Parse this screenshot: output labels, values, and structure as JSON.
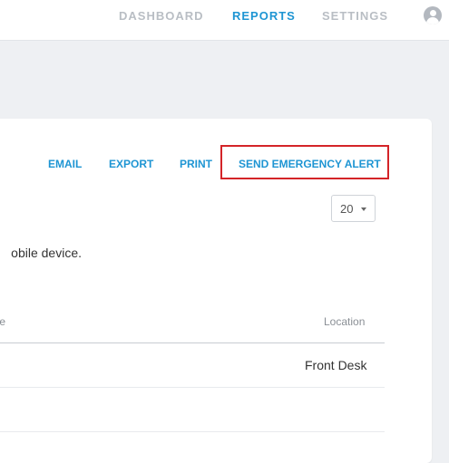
{
  "nav": {
    "items": [
      {
        "label": "DASHBOARD"
      },
      {
        "label": "REPORTS"
      },
      {
        "label": "SETTINGS"
      }
    ],
    "active": "REPORTS",
    "user_icon": "user-circle-icon"
  },
  "actions": {
    "email_label": "EMAIL",
    "export_label": "EXPORT",
    "print_label": "PRINT",
    "emergency_label": "SEND EMERGENCY ALERT"
  },
  "page_size": {
    "value": "20",
    "icon": "caret-down-icon"
  },
  "description": "obile device.",
  "table": {
    "columns": [
      "one",
      "Location"
    ],
    "rows": [
      {
        "location": "Front Desk"
      }
    ]
  },
  "colors": {
    "accent": "#1e95d3",
    "highlight": "#d42428",
    "nav_inactive": "#b9bec4"
  }
}
